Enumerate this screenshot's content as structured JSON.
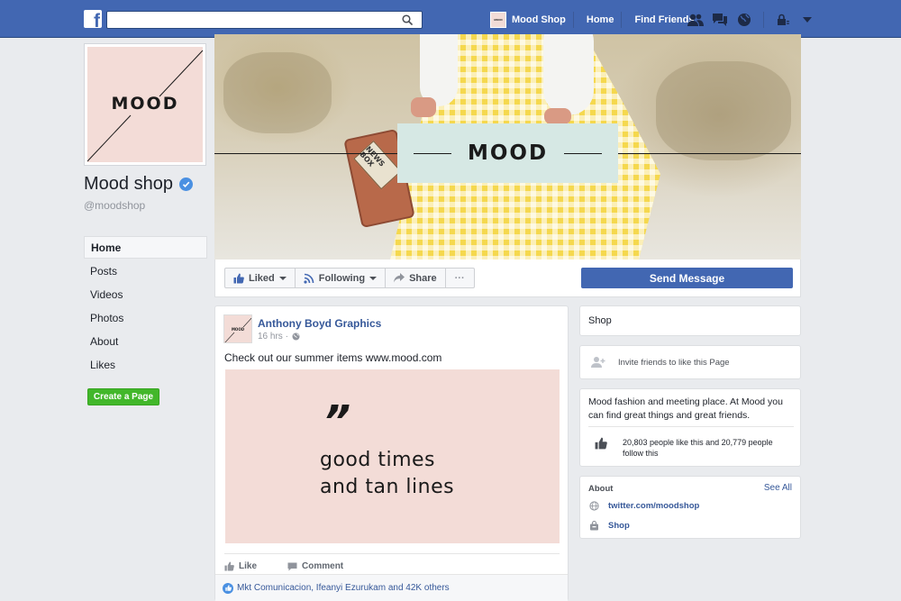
{
  "topbar": {
    "logo_letter": "f",
    "search_placeholder": "",
    "page_shortcut_avatar": "MOOD",
    "page_shortcut_label": "Mood Shop",
    "home_label": "Home",
    "find_friends_label": "Find Friends",
    "icons": [
      "friends-icon",
      "messages-icon",
      "globe-icon",
      "privacy-lock-icon",
      "account-caret-icon"
    ]
  },
  "profile": {
    "picture_text": "MOOD",
    "page_name": "Mood shop",
    "handle": "@moodshop",
    "verified": true
  },
  "leftnav": {
    "items": [
      {
        "label": "Home",
        "active": true
      },
      {
        "label": "Posts",
        "active": false
      },
      {
        "label": "Videos",
        "active": false
      },
      {
        "label": "Photos",
        "active": false
      },
      {
        "label": "About",
        "active": false
      },
      {
        "label": "Likes",
        "active": false
      }
    ],
    "create_page_label": "Create a Page"
  },
  "cover": {
    "title": "MOOD",
    "suitcase_label": "NEWS BOX"
  },
  "actionbar": {
    "liked_label": "Liked",
    "following_label": "Following",
    "share_label": "Share",
    "more_label": "···",
    "send_message_label": "Send Message"
  },
  "post": {
    "avatar_text": "MOOD",
    "author": "Anthony Boyd Graphics",
    "time": "16 hrs ·",
    "text": "Check out our summer items www.mood.com",
    "image_quote_mark": "”",
    "image_line1": "good times",
    "image_line2": "and tan lines",
    "like_label": "Like",
    "comment_label": "Comment",
    "likes_summary": "Mkt Comunicacion, Ifeanyi Ezurukam and 42K others"
  },
  "sidebar": {
    "shop_label": "Shop",
    "invite_label": "Invite friends to like this Page",
    "description": "Mood fashion and meeting place. At Mood you can find great things and great friends.",
    "likes_follow": "20,803 people like this and 20,779 people follow this",
    "about_header": "About",
    "see_all_label": "See All",
    "twitter_link": "twitter.com/moodshop",
    "shop_link": "Shop"
  },
  "colors": {
    "facebook_blue": "#4267b2",
    "link_blue": "#365899",
    "create_green": "#42b72a",
    "mood_pink": "#f3dcd7",
    "cover_box_mint": "#d6e8e4",
    "dress_yellow": "#f5d84e",
    "background_gray": "#e9ebee"
  }
}
